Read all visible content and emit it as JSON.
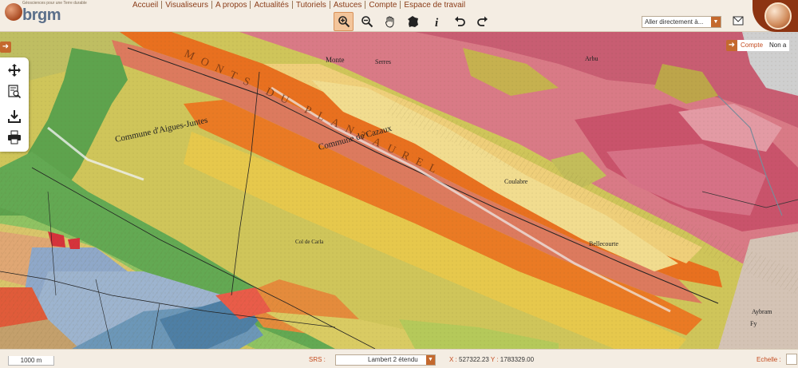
{
  "brand": {
    "name": "brgm",
    "tagline": "Géosciences pour une Terre durable"
  },
  "nav": [
    {
      "label": "Accueil"
    },
    {
      "label": "Visualiseurs"
    },
    {
      "label": "A propos"
    },
    {
      "label": "Actualités"
    },
    {
      "label": "Tutoriels"
    },
    {
      "label": "Astuces"
    },
    {
      "label": "Compte"
    },
    {
      "label": "Espace de travail"
    }
  ],
  "toolbar": {
    "tools": [
      {
        "icon": "zoom-in-icon",
        "active": true
      },
      {
        "icon": "zoom-out-icon",
        "active": false
      },
      {
        "icon": "pan-hand-icon",
        "active": false
      },
      {
        "icon": "france-map-icon",
        "active": false
      },
      {
        "icon": "info-icon",
        "active": false
      },
      {
        "icon": "undo-icon",
        "active": false
      },
      {
        "icon": "redo-icon",
        "active": false
      }
    ],
    "goto_label": "Aller directement à..."
  },
  "side_tools": [
    "move-arrows-icon",
    "legend-search-icon",
    "download-icon",
    "print-icon"
  ],
  "account": {
    "label": "Compte",
    "value": "Non a"
  },
  "map": {
    "labels": [
      "Commune d'Aigues-Juntes",
      "Commune de Cazaux",
      "Col de Carla",
      "Monte",
      "Arbu",
      "Serres",
      "Coulabre",
      "Bellecourte",
      "Aybram",
      "Fy",
      "MONTS DU PLANTAUREL"
    ]
  },
  "status": {
    "scale": "1000 m",
    "srs_label": "SRS :",
    "srs_value": "Lambert 2 étendu",
    "x_label": "X :",
    "x_value": "527322.23",
    "y_label": "Y :",
    "y_value": "1783329.00",
    "scale_label": "Echelle :"
  },
  "colors": {
    "accent": "#c4692e",
    "brand_dark": "#8d3412",
    "nav_text": "#8a3c18"
  }
}
